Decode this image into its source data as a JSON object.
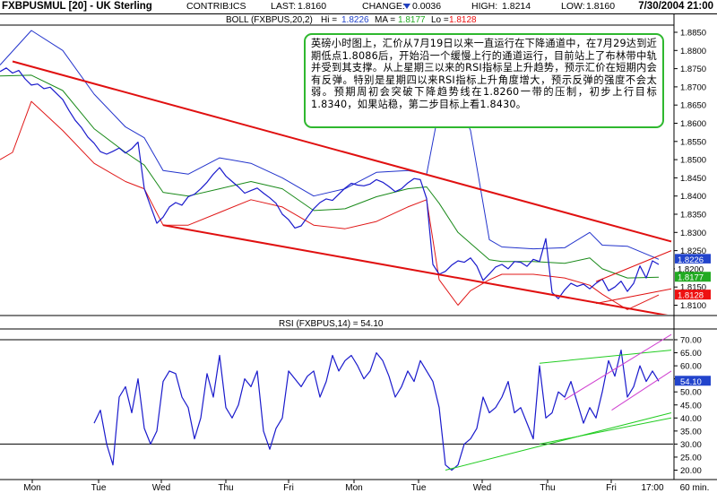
{
  "header": {
    "symbol": "FXBPUSMUL [20] - UK Sterling",
    "contrib_label": "CONTRIB:",
    "contrib_value": "ICS",
    "last_label": "LAST:",
    "last_value": "1.8160",
    "change_label": "CHANGE:",
    "change_value": "0.0036",
    "high_label": "HIGH:",
    "high_value": "1.8214",
    "low_label": "LOW:",
    "low_value": "1.8160",
    "datetime": "7/30/2004 21:00"
  },
  "boll_legend": {
    "name": "BOLL (FXBPUS,20,2)",
    "hi_label": "Hi =",
    "hi_value": "1.8226",
    "ma_label": "MA =",
    "ma_value": "1.8177",
    "lo_label": "Lo =",
    "lo_value": "1.8128"
  },
  "rsi_legend": {
    "text": "RSI (FXBPUS,14) = 54.10"
  },
  "annotation": "英磅小时图上，汇价从7月19日以来一直运行在下降通道中，在7月29达到近期低点1.8086后，开始沿一个缓慢上行的通道运行，目前站上了布林带中轨并受到其支撑。从上星期三以来的RSI指标呈上升趋势，预示汇价在短期内会有反弹。特别是星期四以来RSI指标上升角度增大，预示反弹的强度不会太弱。预期周初会突破下降趋势线在1.8260一带的压制，初步上行目标1.8340，如果站稳，第二步目标上看1.8430。",
  "colors": {
    "price": "#1a1acc",
    "boll_upper": "#2233cc",
    "boll_ma": "#1a8a1a",
    "boll_lower": "#e01818",
    "trend_red": "#e01010",
    "trend_green": "#22cc22",
    "trend_magenta": "#d040d0",
    "hi_badge": "#2244cc",
    "ma_badge": "#22aa22",
    "lo_badge": "#ee1111",
    "rsi_badge": "#2244cc",
    "note_border": "#2fb82f"
  },
  "chart_data": [
    {
      "type": "line",
      "title": "FXBPUSMUL [20] - UK Sterling",
      "interval": "60 min.",
      "x_ticks": [
        "Mon",
        "Tue",
        "Wed",
        "Thu",
        "Fri",
        "Mon",
        "Tue",
        "Wed",
        "Thu",
        "Fri",
        "17:00"
      ],
      "y_ticks": [
        "1.8850",
        "1.8800",
        "1.8750",
        "1.8700",
        "1.8650",
        "1.8600",
        "1.8550",
        "1.8500",
        "1.8450",
        "1.8400",
        "1.8350",
        "1.8300",
        "1.8250",
        "1.8200",
        "1.8150",
        "1.8100"
      ],
      "ylim": [
        1.808,
        1.887
      ],
      "grid": false,
      "series": [
        {
          "name": "FXBPUS",
          "x": [
            0,
            2,
            4,
            6,
            8,
            10,
            12,
            14,
            16,
            18,
            20,
            22,
            24,
            26,
            28,
            30,
            32,
            34,
            36,
            38,
            40,
            42,
            44,
            46,
            48,
            50,
            52,
            54,
            56,
            58,
            60,
            62,
            64,
            66,
            68,
            70,
            72,
            74,
            76,
            78,
            80,
            82,
            84,
            86,
            88,
            90,
            92,
            94,
            96,
            98,
            100,
            102,
            104,
            106,
            108,
            110,
            112,
            114,
            116,
            118,
            120,
            122,
            124,
            126,
            128,
            130,
            132,
            134,
            136,
            138,
            140,
            142,
            144,
            146,
            148,
            150,
            152,
            154,
            156,
            158,
            160,
            162,
            164,
            166,
            168,
            170,
            172,
            174,
            176,
            178,
            180,
            182,
            184,
            186,
            188,
            190,
            192,
            194,
            196,
            198,
            200,
            202,
            204,
            206,
            208,
            210
          ],
          "values": [
            1.8742,
            1.8752,
            1.8738,
            1.8745,
            1.8722,
            1.8705,
            1.8708,
            1.8695,
            1.8699,
            1.8682,
            1.8665,
            1.8635,
            1.8608,
            1.8588,
            1.8562,
            1.8545,
            1.8522,
            1.8515,
            1.8523,
            1.8532,
            1.8518,
            1.853,
            1.8548,
            1.842,
            1.8372,
            1.8325,
            1.8342,
            1.837,
            1.8382,
            1.8375,
            1.8398,
            1.8405,
            1.842,
            1.8438,
            1.846,
            1.8478,
            1.8455,
            1.844,
            1.8425,
            1.8408,
            1.8415,
            1.8422,
            1.8408,
            1.8395,
            1.838,
            1.835,
            1.8335,
            1.8312,
            1.8318,
            1.8342,
            1.8365,
            1.8382,
            1.8392,
            1.8388,
            1.8405,
            1.8422,
            1.8435,
            1.843,
            1.8428,
            1.8433,
            1.8445,
            1.8438,
            1.8426,
            1.8412,
            1.842,
            1.8436,
            1.8448,
            1.8445,
            1.8393,
            1.8212,
            1.8185,
            1.8193,
            1.821,
            1.8222,
            1.8218,
            1.823,
            1.8208,
            1.8168,
            1.8186,
            1.8205,
            1.8212,
            1.82,
            1.822,
            1.8218,
            1.8207,
            1.8226,
            1.822,
            1.8283,
            1.8135,
            1.8118,
            1.8142,
            1.816,
            1.8152,
            1.8158,
            1.8145,
            1.816,
            1.8172,
            1.814,
            1.815,
            1.8166,
            1.8138,
            1.816,
            1.8208,
            1.8175,
            1.8222,
            1.8212
          ]
        },
        {
          "name": "BOLL Hi",
          "x": [
            0,
            10,
            20,
            30,
            40,
            46,
            52,
            60,
            70,
            80,
            90,
            100,
            110,
            120,
            130,
            136,
            140,
            146,
            150,
            156,
            160,
            170,
            180,
            188,
            192,
            200,
            210
          ],
          "values": [
            1.876,
            1.8855,
            1.88,
            1.868,
            1.859,
            1.856,
            1.847,
            1.846,
            1.8505,
            1.849,
            1.845,
            1.84,
            1.842,
            1.8465,
            1.847,
            1.846,
            1.864,
            1.866,
            1.858,
            1.828,
            1.826,
            1.8255,
            1.8258,
            1.83,
            1.8265,
            1.8262,
            1.8226
          ]
        },
        {
          "name": "BOLL MA",
          "x": [
            0,
            10,
            20,
            30,
            40,
            46,
            52,
            60,
            70,
            80,
            90,
            100,
            110,
            120,
            130,
            136,
            140,
            146,
            150,
            156,
            160,
            170,
            180,
            188,
            192,
            200,
            210
          ],
          "values": [
            1.873,
            1.8732,
            1.869,
            1.8585,
            1.852,
            1.8485,
            1.841,
            1.84,
            1.842,
            1.844,
            1.842,
            1.836,
            1.8365,
            1.8398,
            1.842,
            1.8425,
            1.838,
            1.83,
            1.827,
            1.8225,
            1.822,
            1.822,
            1.8215,
            1.823,
            1.82,
            1.8175,
            1.8177
          ]
        },
        {
          "name": "BOLL Lo",
          "x": [
            0,
            4,
            10,
            20,
            30,
            40,
            46,
            52,
            60,
            70,
            80,
            90,
            100,
            110,
            120,
            130,
            136,
            140,
            146,
            150,
            156,
            160,
            170,
            180,
            188,
            192,
            200,
            210
          ],
          "values": [
            1.85,
            1.852,
            1.866,
            1.858,
            1.849,
            1.844,
            1.842,
            1.832,
            1.832,
            1.8355,
            1.839,
            1.837,
            1.832,
            1.831,
            1.833,
            1.837,
            1.839,
            1.817,
            1.81,
            1.814,
            1.817,
            1.8185,
            1.8185,
            1.8175,
            1.8155,
            1.813,
            1.8088,
            1.8128
          ]
        }
      ],
      "trendlines": [
        {
          "color": "red",
          "from": [
            4,
            1.877
          ],
          "to": [
            214,
            1.8275
          ]
        },
        {
          "color": "red",
          "from": [
            52,
            1.832
          ],
          "to": [
            214,
            1.807
          ]
        },
        {
          "color": "red",
          "from": [
            190,
            1.8165
          ],
          "to": [
            214,
            1.825
          ]
        },
        {
          "color": "red",
          "from": [
            190,
            1.8105
          ],
          "to": [
            214,
            1.8145
          ]
        }
      ],
      "badges": [
        {
          "label": "1.8226",
          "value": 1.8226
        },
        {
          "label": "1.8200",
          "value": 1.82
        },
        {
          "label": "1.8177",
          "value": 1.8177
        },
        {
          "label": "1.8128",
          "value": 1.8128
        }
      ]
    },
    {
      "type": "line",
      "title": "RSI (FXBPUS,14) = 54.10",
      "y_ticks": [
        "70.00",
        "65.00",
        "60.00",
        "55.00",
        "50.00",
        "45.00",
        "40.00",
        "35.00",
        "30.00",
        "25.00",
        "20.00"
      ],
      "ylim": [
        18,
        72
      ],
      "reference_lines": [
        70,
        30
      ],
      "series": [
        {
          "name": "RSI",
          "x": [
            30,
            32,
            34,
            36,
            38,
            40,
            42,
            44,
            46,
            48,
            50,
            52,
            54,
            56,
            58,
            60,
            62,
            64,
            66,
            68,
            70,
            72,
            74,
            76,
            78,
            80,
            82,
            84,
            86,
            88,
            90,
            92,
            94,
            96,
            98,
            100,
            102,
            104,
            106,
            108,
            110,
            112,
            114,
            116,
            118,
            120,
            122,
            124,
            126,
            128,
            130,
            132,
            134,
            136,
            138,
            140,
            142,
            144,
            146,
            148,
            150,
            152,
            154,
            156,
            158,
            160,
            162,
            164,
            166,
            168,
            170,
            172,
            174,
            176,
            178,
            180,
            182,
            184,
            186,
            188,
            190,
            192,
            194,
            196,
            198,
            200,
            202,
            204,
            206,
            208,
            210
          ],
          "values": [
            38,
            43,
            30,
            22,
            48,
            52,
            42,
            55,
            36,
            30,
            35,
            54,
            58,
            57,
            48,
            44,
            32,
            40,
            57,
            48,
            64,
            44,
            40,
            45,
            55,
            52,
            58,
            35,
            28,
            36,
            40,
            58,
            55,
            52,
            56,
            58,
            48,
            54,
            64,
            58,
            62,
            64,
            60,
            55,
            58,
            65,
            62,
            56,
            48,
            52,
            58,
            54,
            62,
            58,
            54,
            44,
            22,
            20,
            22,
            30,
            32,
            36,
            48,
            42,
            44,
            48,
            54,
            42,
            44,
            38,
            32,
            60,
            40,
            42,
            50,
            48,
            54,
            46,
            38,
            44,
            40,
            50,
            62,
            56,
            66,
            48,
            52,
            60,
            54,
            58,
            54.1
          ]
        }
      ],
      "trendlines": [
        {
          "color": "green",
          "from": [
            142,
            20
          ],
          "to": [
            214,
            42
          ]
        },
        {
          "color": "green",
          "from": [
            172,
            61
          ],
          "to": [
            214,
            66
          ]
        },
        {
          "color": "green",
          "from": [
            172,
            30
          ],
          "to": [
            214,
            40
          ]
        },
        {
          "color": "magenta",
          "from": [
            180,
            47
          ],
          "to": [
            214,
            72
          ]
        },
        {
          "color": "magenta",
          "from": [
            195,
            43
          ],
          "to": [
            214,
            58
          ]
        }
      ],
      "badges": [
        {
          "label": "54.10",
          "value": 54.1
        }
      ]
    }
  ]
}
